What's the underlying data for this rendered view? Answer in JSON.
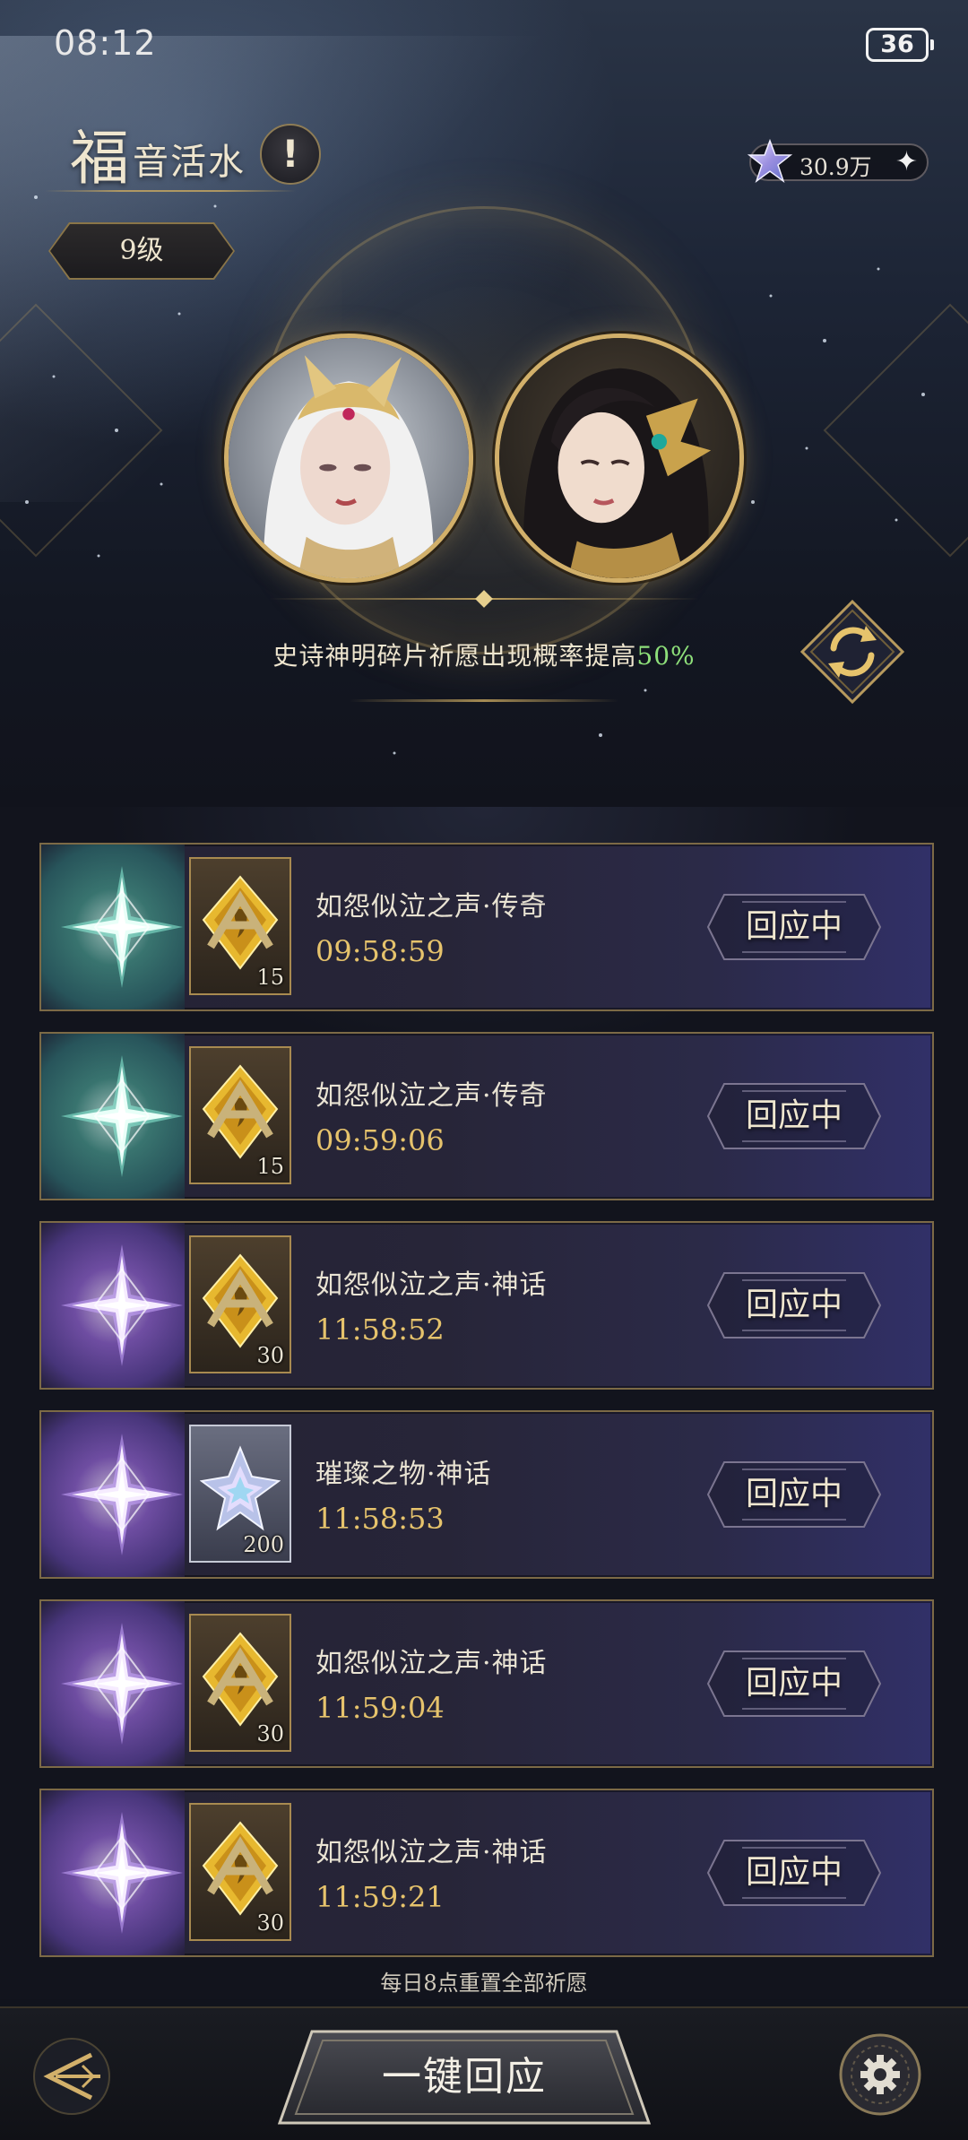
{
  "status_bar": {
    "time": "08:12",
    "battery": "36"
  },
  "header": {
    "title_big": "福",
    "title_small": "音活水",
    "info_icon": "exclamation-icon",
    "level": "9级",
    "currency": {
      "icon": "star-crystal-icon",
      "value": "30.9万",
      "add_icon": "plus-icon"
    }
  },
  "bonus": {
    "text": "史诗神明碎片祈愿出现概率提高",
    "percent": "50%"
  },
  "refresh_icon": "refresh-icon",
  "requests": [
    {
      "rarity": "legend",
      "item": "shard",
      "qty": "15",
      "name": "如怨似泣之声·传奇",
      "timer": "09:58:59",
      "status": "回应中"
    },
    {
      "rarity": "legend",
      "item": "shard",
      "qty": "15",
      "name": "如怨似泣之声·传奇",
      "timer": "09:59:06",
      "status": "回应中"
    },
    {
      "rarity": "myth",
      "item": "shard",
      "qty": "30",
      "name": "如怨似泣之声·神话",
      "timer": "11:58:52",
      "status": "回应中"
    },
    {
      "rarity": "myth",
      "item": "crystal",
      "qty": "200",
      "name": "璀璨之物·神话",
      "timer": "11:58:53",
      "status": "回应中"
    },
    {
      "rarity": "myth",
      "item": "shard",
      "qty": "30",
      "name": "如怨似泣之声·神话",
      "timer": "11:59:04",
      "status": "回应中"
    },
    {
      "rarity": "myth",
      "item": "shard",
      "qty": "30",
      "name": "如怨似泣之声·神话",
      "timer": "11:59:21",
      "status": "回应中"
    }
  ],
  "reset_note": "每日8点重置全部祈愿",
  "bottom": {
    "main_button": "一键回应",
    "back_icon": "back-arrow-icon",
    "settings_icon": "gear-icon"
  },
  "colors": {
    "gold": "#d2b06a",
    "timer": "#e6c36c",
    "highlight": "#8ee07a",
    "legend": "#46aa96",
    "myth": "#9664dc"
  }
}
